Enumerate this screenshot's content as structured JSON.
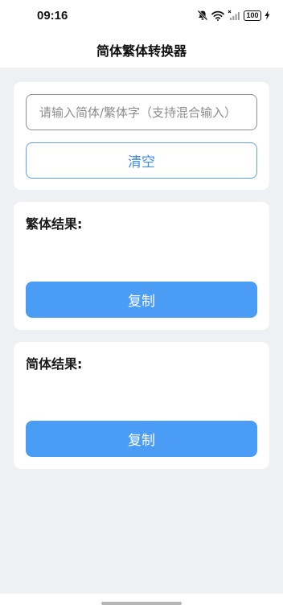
{
  "status_bar": {
    "time": "09:16",
    "battery": "100",
    "icons": [
      "mute-bell-icon",
      "wifi-icon",
      "signal-icon",
      "battery-icon",
      "charging-icon"
    ]
  },
  "header": {
    "title": "简体繁体转换器"
  },
  "input_card": {
    "placeholder": "请输入简体/繁体字（支持混合输入）",
    "value": "",
    "clear_label": "清空"
  },
  "traditional_card": {
    "label": "繁体结果:",
    "result": "",
    "copy_label": "复制"
  },
  "simplified_card": {
    "label": "简体结果:",
    "result": "",
    "copy_label": "复制"
  },
  "colors": {
    "accent": "#4a9cf5",
    "background": "#eff0f4",
    "card": "#ffffff"
  }
}
